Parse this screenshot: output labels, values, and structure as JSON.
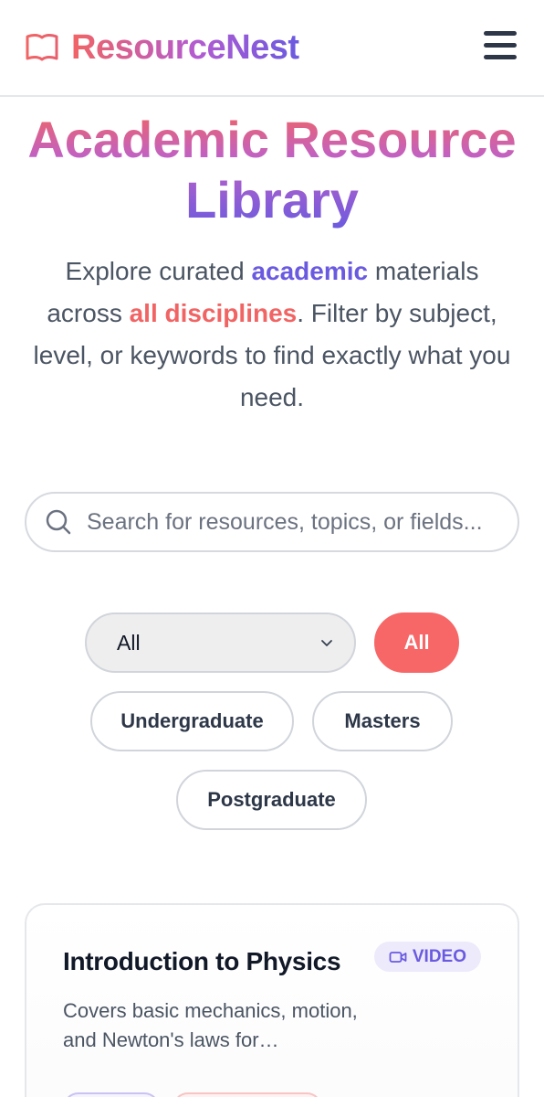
{
  "header": {
    "brand": "ResourceNest",
    "logo_icon": "open-book-icon",
    "menu_icon": "hamburger-menu-icon"
  },
  "hero": {
    "title": "Academic Resource Library",
    "subtitle_parts": [
      "Explore curated ",
      "academic",
      " materials across ",
      "all disciplines",
      ". Filter by subject, level, or keywords to find exactly what you need."
    ]
  },
  "search": {
    "icon": "search-icon",
    "placeholder": "Search for resources, topics, or fields...",
    "value": ""
  },
  "filters": {
    "subject_select": {
      "selected": "All",
      "icon": "chevron-down-icon"
    },
    "levels": [
      {
        "label": "All",
        "active": true
      },
      {
        "label": "Undergraduate",
        "active": false
      },
      {
        "label": "Masters",
        "active": false
      },
      {
        "label": "Postgraduate",
        "active": false
      }
    ]
  },
  "cards": [
    {
      "title": "Introduction to Physics",
      "badge": "VIDEO",
      "badge_icon": "video-camera-icon",
      "description": "Covers basic mechanics, motion, and Newton's laws for…"
    }
  ],
  "colors": {
    "accent_red": "#f16464",
    "accent_purple": "#6a5ae0",
    "text_dark": "#1f2937",
    "border": "#d1d5db"
  }
}
